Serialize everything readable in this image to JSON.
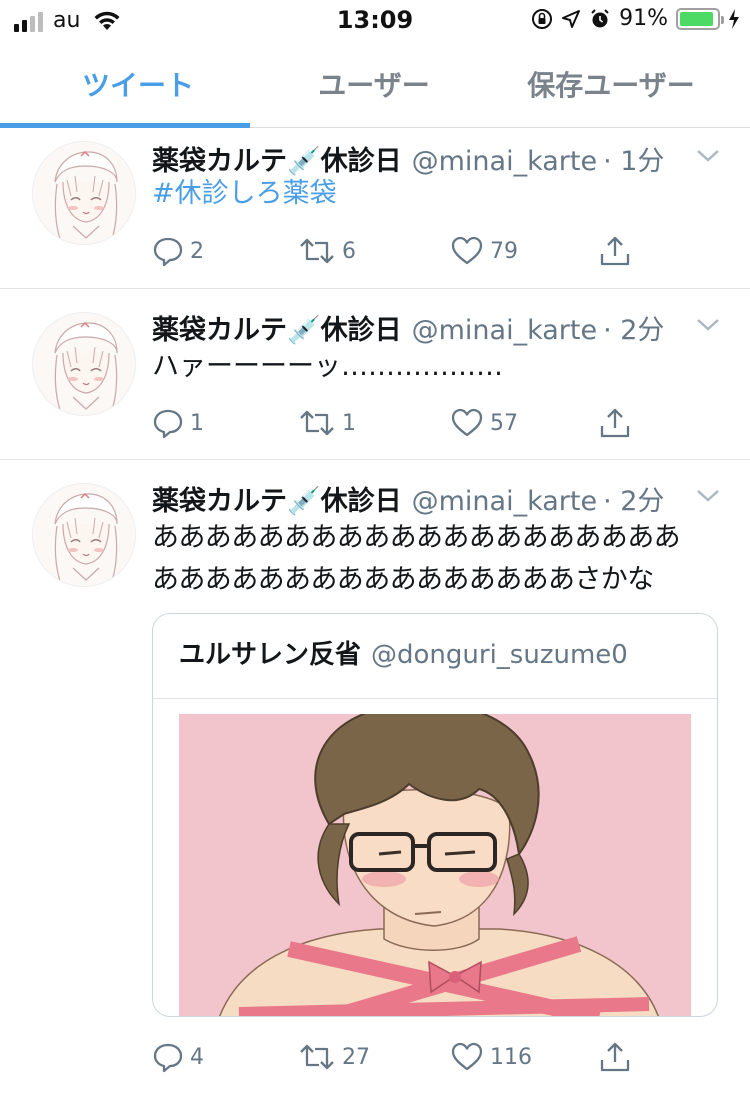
{
  "status_bar": {
    "carrier": "au",
    "time": "13:09",
    "battery_percent": "91%",
    "battery_level": 0.91,
    "battery_color": "#4cd964",
    "icons": [
      "signal-icon",
      "wifi-icon",
      "orientation-lock-icon",
      "location-icon",
      "alarm-icon",
      "battery-icon",
      "charging-icon"
    ]
  },
  "tabs": [
    {
      "label": "ツイート",
      "active": true
    },
    {
      "label": "ユーザー",
      "active": false
    },
    {
      "label": "保存ユーザー",
      "active": false
    }
  ],
  "accent_color": "#4a9ee8",
  "tweets": [
    {
      "author": "薬袋カルテ💉休診日",
      "handle": "@minai_karte",
      "time": "· 1分",
      "text": "#休診しろ薬袋",
      "replies": "2",
      "retweets": "6",
      "likes": "79"
    },
    {
      "author": "薬袋カルテ💉休診日",
      "handle": "@minai_karte",
      "time": "· 2分",
      "text": "ハァーーーーッ………………",
      "replies": "1",
      "retweets": "1",
      "likes": "57"
    },
    {
      "author": "薬袋カルテ💉休診日",
      "handle": "@minai_karte",
      "time": "· 2分",
      "text_line1": "ああああああああああああああああああああ",
      "text_line2": "ああああああああああああああああさかな",
      "quote": {
        "author": "ユルサレン反省",
        "handle": "@donguri_suzume0"
      },
      "replies": "4",
      "retweets": "27",
      "likes": "116"
    }
  ]
}
